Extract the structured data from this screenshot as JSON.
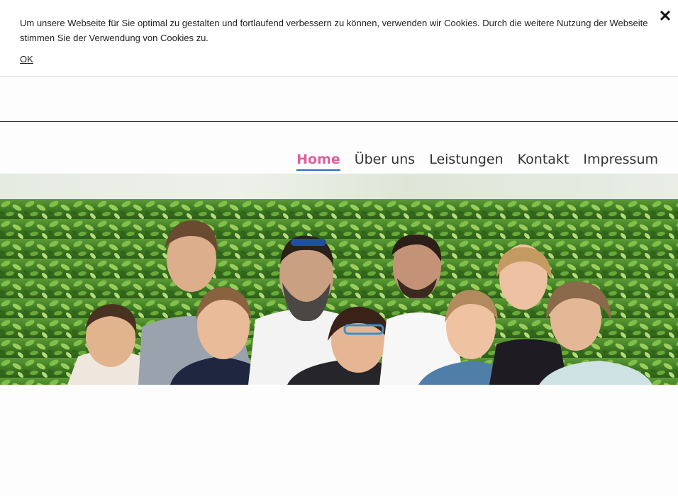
{
  "cookie": {
    "text": "Um unsere Webseite für Sie optimal zu gestalten und fortlaufend verbessern zu können, verwenden wir Cookies. Durch die weitere Nutzung der Webseite stimmen Sie der Verwendung von Cookies zu.",
    "ok_label": "OK",
    "close_glyph": "✕"
  },
  "nav": {
    "items": [
      {
        "label": "Home",
        "active": true
      },
      {
        "label": "Über uns",
        "active": false
      },
      {
        "label": "Leistungen",
        "active": false
      },
      {
        "label": "Kontakt",
        "active": false
      },
      {
        "label": "Impressum",
        "active": false
      }
    ]
  },
  "colors": {
    "nav_active": "#e0609a",
    "nav_underline": "#2e6dbf",
    "nav_text": "#333333",
    "foliage": "#3f7a23"
  },
  "hero": {
    "image_icon": "team-photo"
  }
}
